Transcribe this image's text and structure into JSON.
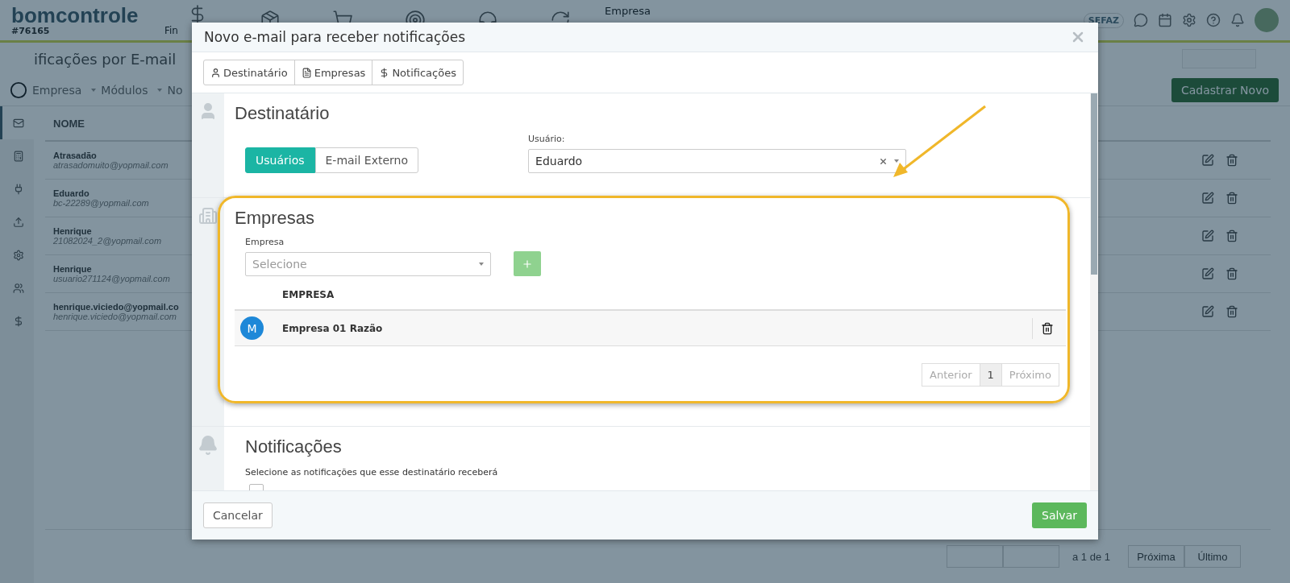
{
  "header": {
    "logo": "bomcontrole",
    "account_id": "#76165",
    "top_nav": [
      {
        "kind": "finance",
        "label": "Fin"
      },
      {
        "kind": "box"
      },
      {
        "kind": "cart"
      },
      {
        "kind": "target"
      },
      {
        "kind": "headset"
      },
      {
        "kind": "cycle"
      }
    ],
    "company_menu": "Empresa",
    "sefaz": "SEFAZ"
  },
  "page": {
    "title": "ificações por E-mail",
    "filters": [
      "Empresa",
      "Módulos",
      "No"
    ],
    "primary_button": "Cadastrar Novo"
  },
  "sidebar": {
    "items": [
      {
        "kind": "mail",
        "selected": true
      },
      {
        "kind": "calculator",
        "selected": false
      },
      {
        "kind": "plug",
        "selected": false
      },
      {
        "kind": "upload",
        "selected": false
      },
      {
        "kind": "gear",
        "selected": false
      },
      {
        "kind": "users",
        "selected": false
      },
      {
        "kind": "dollar",
        "selected": false
      }
    ]
  },
  "table": {
    "columns": [
      "NOME"
    ],
    "rows": [
      {
        "name": "Atrasadão",
        "email": "atrasadomuito@yopmail.com"
      },
      {
        "name": "Eduardo",
        "email": "bc-22289@yopmail.com"
      },
      {
        "name": "Henrique",
        "email": "21082024_2@yopmail.com"
      },
      {
        "name": "Henrique",
        "email": "usuario271124@yopmail.com"
      },
      {
        "name": "henrique.viciedo@yopmail.co",
        "email": "henrique.viciedo@yopmail.com"
      }
    ]
  },
  "pagination": {
    "summary": "a 1 de 1",
    "buttons": [
      "Próxima",
      "Último"
    ]
  },
  "modal": {
    "title": "Novo e-mail para receber notificações",
    "tabs": [
      {
        "kind": "user",
        "label": "Destinatário"
      },
      {
        "kind": "file",
        "label": "Empresas"
      },
      {
        "kind": "dollar",
        "label": "Notificações"
      }
    ],
    "recipient": {
      "title": "Destinatário",
      "toggle": [
        {
          "label": "Usuários",
          "selected": true
        },
        {
          "label": "E-mail Externo",
          "selected": false
        }
      ],
      "user_label": "Usuário:",
      "user_value": "Eduardo"
    },
    "companies": {
      "title": "Empresas",
      "field_label": "Empresa",
      "placeholder": "Selecione",
      "columns": [
        "EMPRESA"
      ],
      "rows": [
        {
          "initial": "M",
          "name": "Empresa 01 Razão"
        }
      ],
      "pages": [
        {
          "label": "Anterior",
          "selected": false
        },
        {
          "label": "1",
          "selected": true
        },
        {
          "label": "Próximo",
          "selected": false
        }
      ]
    },
    "notifications": {
      "title": "Notificações",
      "subtitle": "Selecione as notificações que esse destinatário receberá",
      "options": [
        {
          "checked": false
        }
      ]
    },
    "cancel": "Cancelar",
    "save": "Salvar"
  }
}
